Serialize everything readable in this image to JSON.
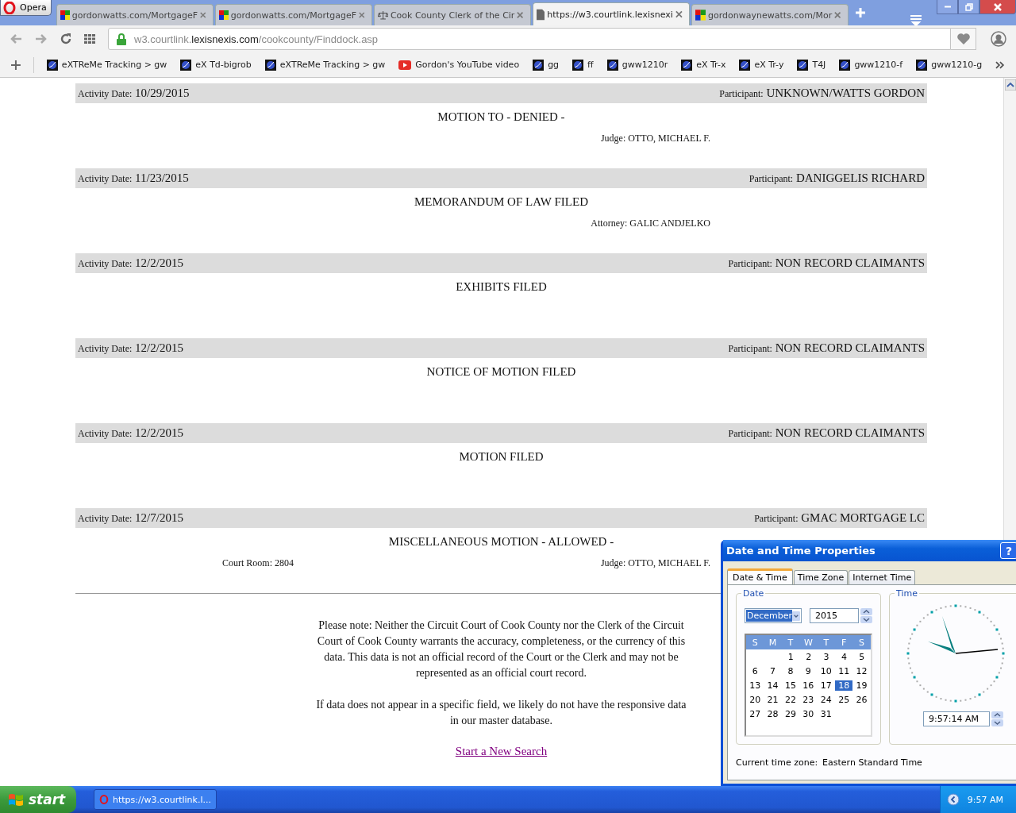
{
  "browser": {
    "menu_button": "Opera",
    "tabs": [
      {
        "title": "gordonwatts.com/MortgageF",
        "kind": "site",
        "selected": false
      },
      {
        "title": "gordonwatts.com/MortgageF",
        "kind": "site",
        "selected": false
      },
      {
        "title": "Cook County Clerk of the Cir",
        "kind": "scales",
        "selected": false
      },
      {
        "title": "https://w3.courtlink.lexisnexi",
        "kind": "page",
        "selected": true
      },
      {
        "title": "gordonwaynewatts.com/Mor",
        "kind": "site",
        "selected": false
      }
    ],
    "address": {
      "prefix": "w3.courtlink.",
      "domain": "lexisnexis.com",
      "path": "/cookcounty/Finddock.asp"
    },
    "bookmarks": [
      {
        "label": "eXTReMe Tracking > gw",
        "kind": "globe"
      },
      {
        "label": "eX Td-bigrob",
        "kind": "globe"
      },
      {
        "label": "eXTReMe Tracking > gw",
        "kind": "globe"
      },
      {
        "label": "Gordon's YouTube video",
        "kind": "video"
      },
      {
        "label": "gg",
        "kind": "globe"
      },
      {
        "label": "ff",
        "kind": "globe"
      },
      {
        "label": "gww1210r",
        "kind": "globe"
      },
      {
        "label": "eX Tr-x",
        "kind": "globe"
      },
      {
        "label": "eX Tr-y",
        "kind": "globe"
      },
      {
        "label": "T4J",
        "kind": "globe"
      },
      {
        "label": "gww1210-f",
        "kind": "globe"
      },
      {
        "label": "gww1210-g",
        "kind": "globe"
      }
    ]
  },
  "page": {
    "records": [
      {
        "date_label": "Activity Date:",
        "date": "10/29/2015",
        "participant_label": "Participant:",
        "participant": "UNKNOWN/WATTS GORDON",
        "action": "MOTION TO - DENIED -",
        "details": [
          {
            "text": "Judge: OTTO, MICHAEL F.",
            "kind": "right"
          }
        ]
      },
      {
        "date_label": "Activity Date:",
        "date": "11/23/2015",
        "participant_label": "Participant:",
        "participant": "DANIGGELIS RICHARD",
        "action": "MEMORANDUM OF LAW FILED",
        "details": [
          {
            "text": "Attorney: GALIC ANDJELKO",
            "kind": "right"
          }
        ]
      },
      {
        "date_label": "Activity Date:",
        "date": "12/2/2015",
        "participant_label": "Participant:",
        "participant": "NON RECORD CLAIMANTS",
        "action": "EXHIBITS FILED"
      },
      {
        "date_label": "Activity Date:",
        "date": "12/2/2015",
        "participant_label": "Participant:",
        "participant": "NON RECORD CLAIMANTS",
        "action": "NOTICE OF MOTION FILED"
      },
      {
        "date_label": "Activity Date:",
        "date": "12/2/2015",
        "participant_label": "Participant:",
        "participant": "NON RECORD CLAIMANTS",
        "action": "MOTION FILED"
      },
      {
        "date_label": "Activity Date:",
        "date": "12/7/2015",
        "participant_label": "Participant:",
        "participant": "GMAC MORTGAGE LC",
        "action": "MISCELLANEOUS MOTION - ALLOWED -",
        "details": [
          {
            "text": "Court Room: 2804",
            "kind": "left"
          },
          {
            "text": "Judge: OTTO, MICHAEL F.",
            "kind": "right"
          }
        ]
      }
    ],
    "notes": [
      "Please note: Neither the Circuit Court of Cook County nor the Clerk of the Circuit Court of Cook County warrants the accuracy, completeness, or the currency of this data. This data is not an official record of the Court or the Clerk and may not be represented as an official court record.",
      "If data does not appear in a specific field, we likely do not have the responsive data in our master database."
    ],
    "link": "Start a New Search"
  },
  "dialog": {
    "title": "Date and Time Properties",
    "help": "?",
    "tabs": [
      {
        "label": "Date & Time",
        "selected": true
      },
      {
        "label": "Time Zone",
        "selected": false
      },
      {
        "label": "Internet Time",
        "selected": false
      }
    ],
    "date_group": "Date",
    "month": "December",
    "year": "2015",
    "weekdays": [
      "S",
      "M",
      "T",
      "W",
      "T",
      "F",
      "S"
    ],
    "weeks": [
      {
        "days": [
          {
            "day": "1",
            "selected": false
          },
          {
            "day": "2",
            "selected": false
          },
          {
            "day": "3",
            "selected": false
          },
          {
            "day": "4",
            "selected": false
          },
          {
            "day": "5",
            "selected": false
          }
        ]
      },
      {
        "days": [
          {
            "day": "6",
            "selected": false
          },
          {
            "day": "7",
            "selected": false
          },
          {
            "day": "8",
            "selected": false
          },
          {
            "day": "9",
            "selected": false
          },
          {
            "day": "10",
            "selected": false
          },
          {
            "day": "11",
            "selected": false
          },
          {
            "day": "12",
            "selected": false
          }
        ]
      },
      {
        "days": [
          {
            "day": "13",
            "selected": false
          },
          {
            "day": "14",
            "selected": false
          },
          {
            "day": "15",
            "selected": false
          },
          {
            "day": "16",
            "selected": false
          },
          {
            "day": "17",
            "selected": false
          },
          {
            "day": "18",
            "selected": true
          },
          {
            "day": "19",
            "selected": false
          }
        ]
      },
      {
        "days": [
          {
            "day": "20",
            "selected": false
          },
          {
            "day": "21",
            "selected": false
          },
          {
            "day": "22",
            "selected": false
          },
          {
            "day": "23",
            "selected": false
          },
          {
            "day": "24",
            "selected": false
          },
          {
            "day": "25",
            "selected": false
          },
          {
            "day": "26",
            "selected": false
          }
        ]
      },
      {
        "days": [
          {
            "day": "27",
            "selected": false
          },
          {
            "day": "28",
            "selected": false
          },
          {
            "day": "29",
            "selected": false
          },
          {
            "day": "30",
            "selected": false
          },
          {
            "day": "31",
            "selected": false
          }
        ]
      }
    ],
    "time_group": "Time",
    "time": "9:57:14 AM",
    "timezone_label": "Current time zone:",
    "timezone": "Eastern Standard Time"
  },
  "taskbar": {
    "start": "start",
    "task": "https://w3.courtlink.l...",
    "clock": "9:57 AM"
  }
}
